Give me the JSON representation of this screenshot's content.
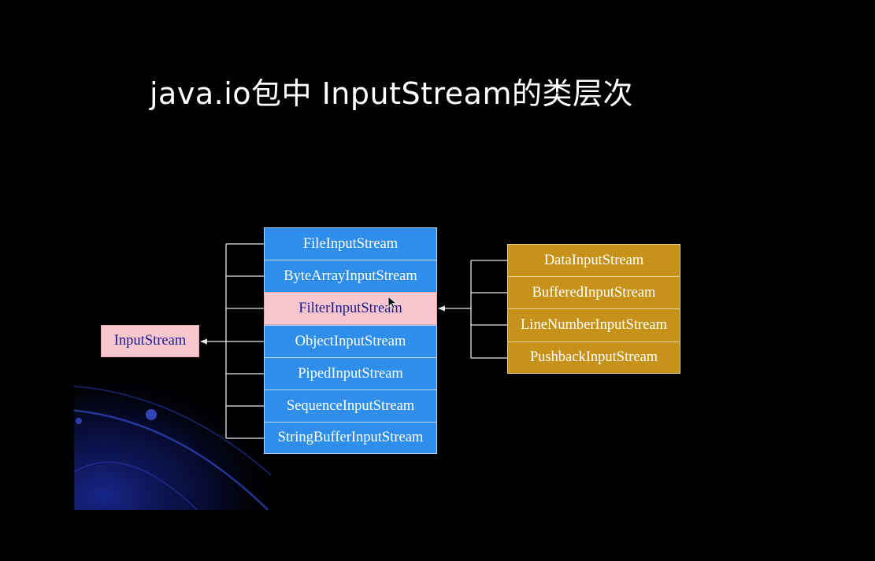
{
  "slide": {
    "title": "java.io包中 InputStream的类层次"
  },
  "diagram": {
    "root": {
      "label": "InputStream"
    },
    "subclasses": [
      {
        "label": "FileInputStream",
        "highlight": false
      },
      {
        "label": "ByteArrayInputStream",
        "highlight": false
      },
      {
        "label": "FilterInputStream",
        "highlight": true
      },
      {
        "label": "ObjectInputStream",
        "highlight": false
      },
      {
        "label": "PipedInputStream",
        "highlight": false
      },
      {
        "label": "SequenceInputStream",
        "highlight": false
      },
      {
        "label": "StringBufferInputStream",
        "highlight": false
      }
    ],
    "filter_subclasses": [
      {
        "label": "DataInputStream"
      },
      {
        "label": "BufferedInputStream"
      },
      {
        "label": "LineNumberInputStream"
      },
      {
        "label": "PushbackInputStream"
      }
    ]
  },
  "colors": {
    "background": "#000000",
    "subclass_box": "#2f8eea",
    "highlight_box": "#f7c6ce",
    "filter_box": "#c7921a",
    "connector": "#e6e6e6",
    "orbit": "#1c2a8a"
  }
}
